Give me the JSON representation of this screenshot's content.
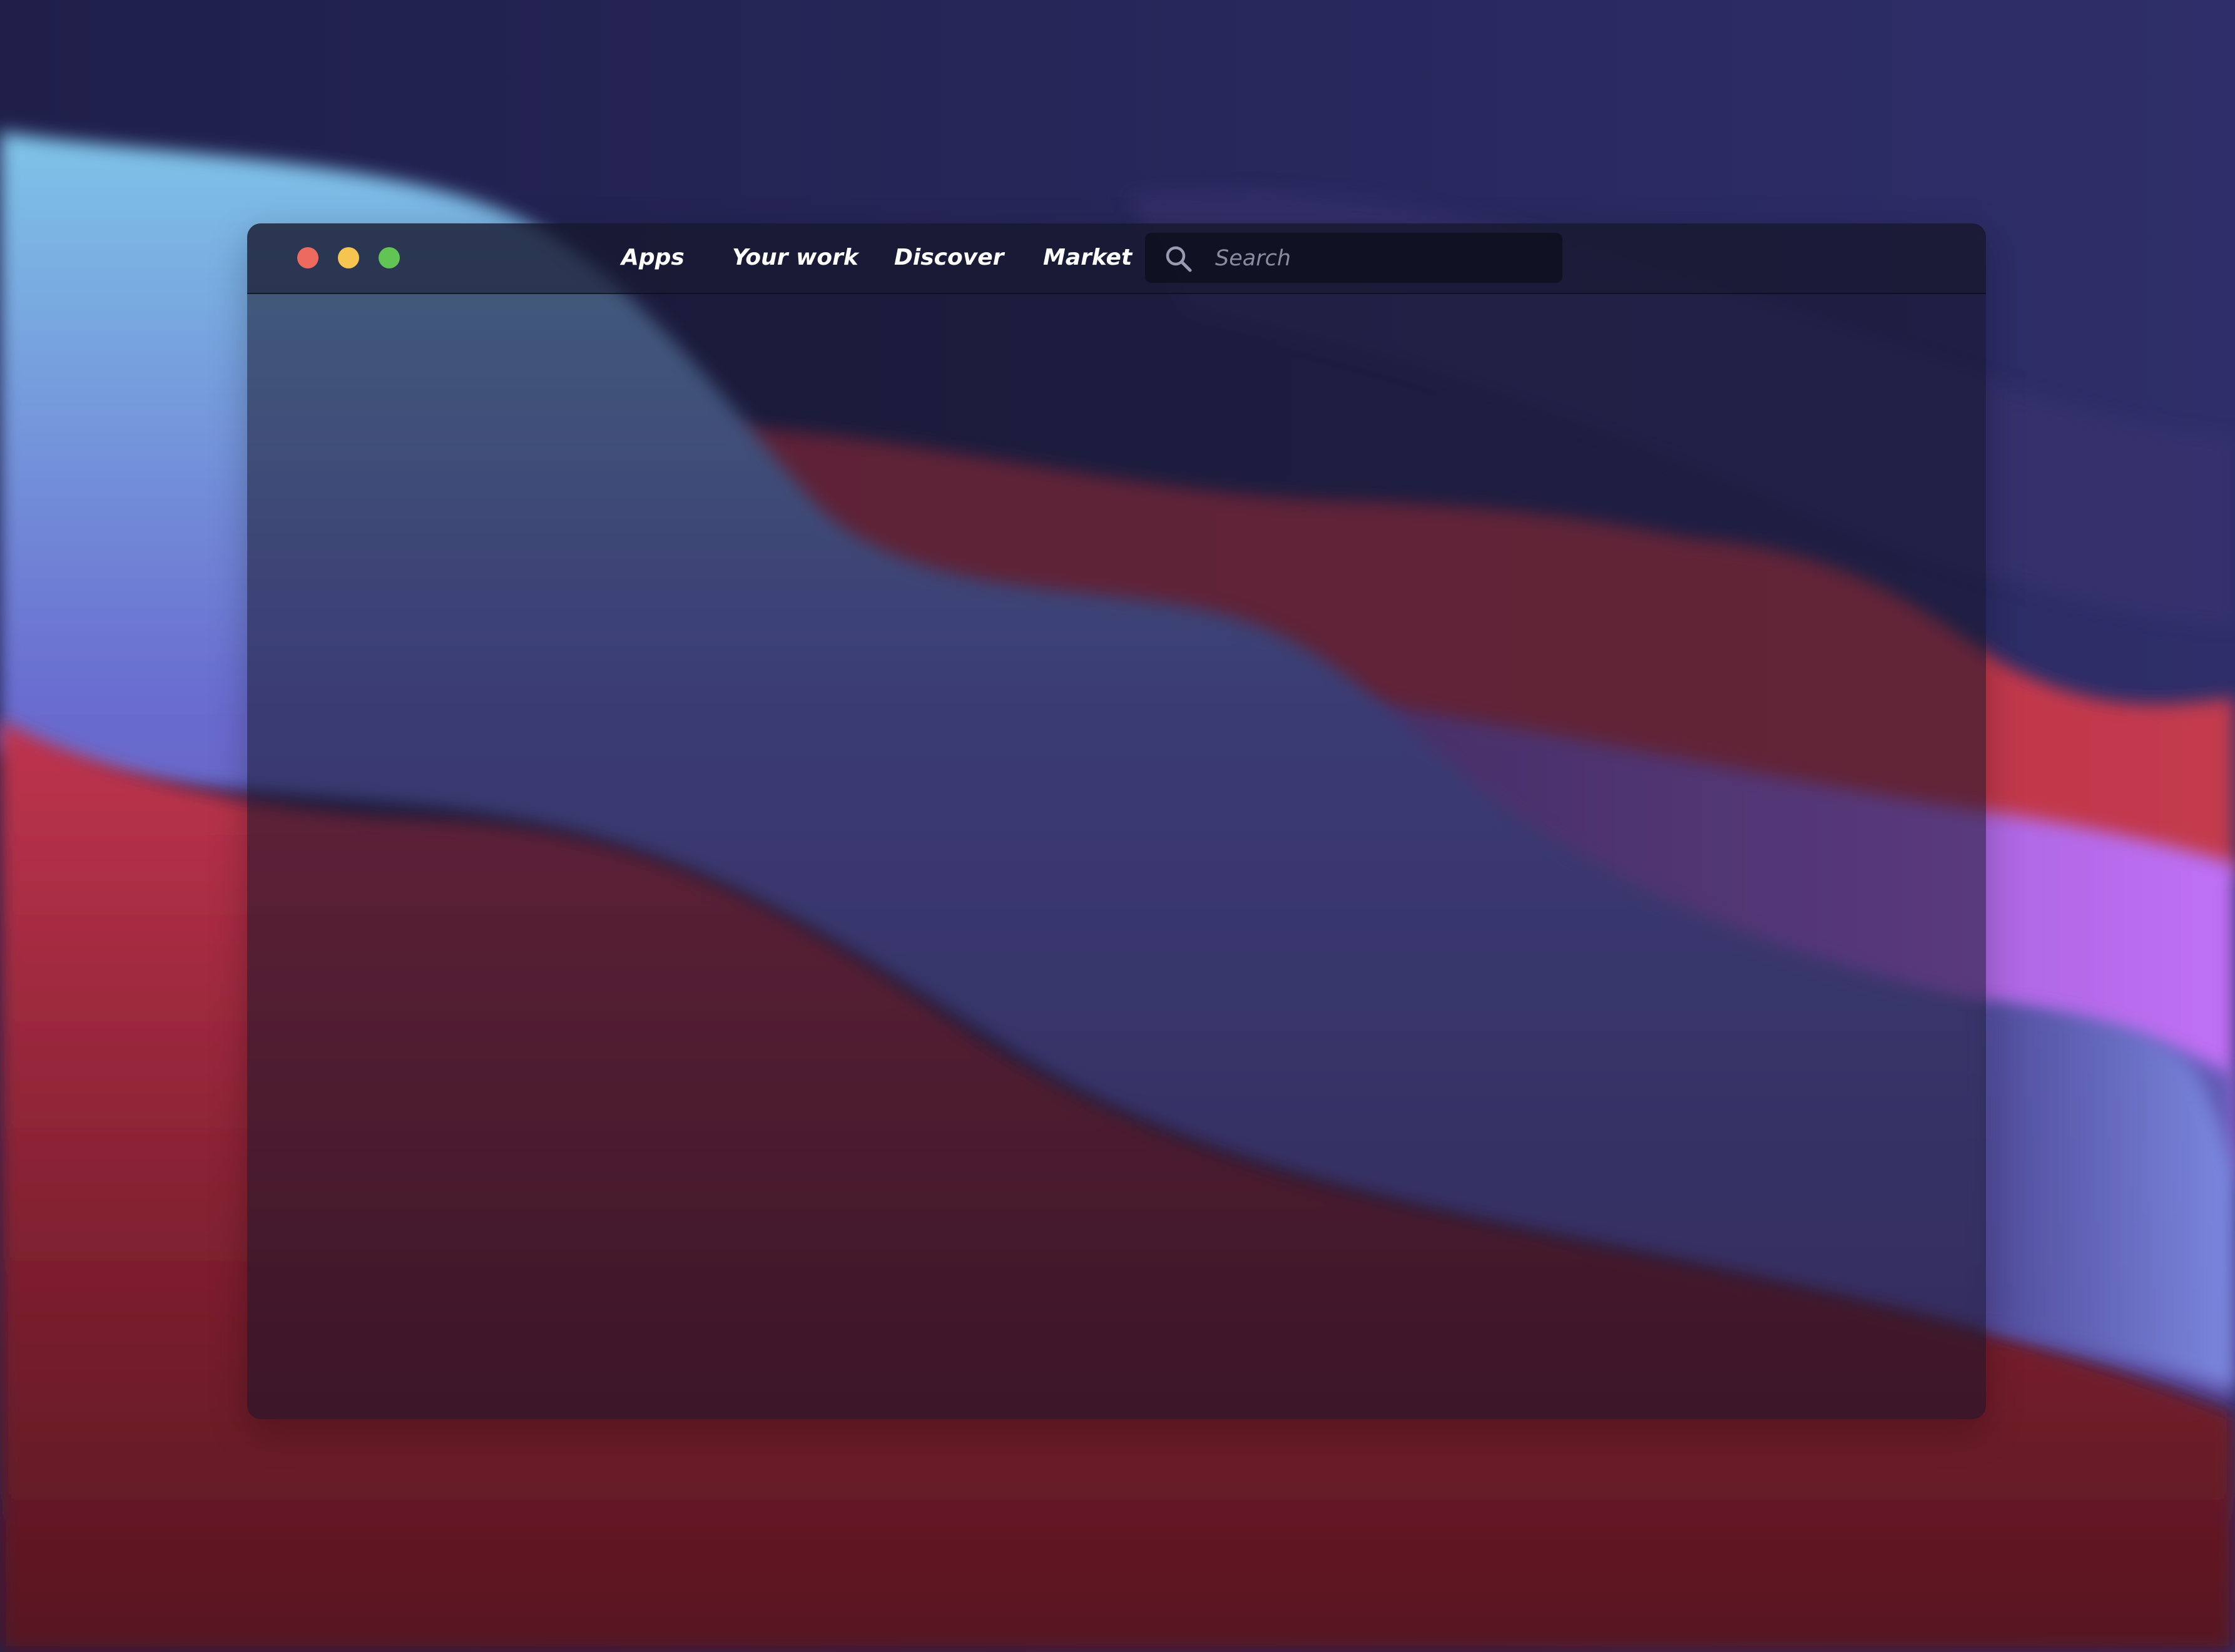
{
  "window": {
    "controls": [
      {
        "name": "close",
        "color": "#ee6a5f"
      },
      {
        "name": "minimize",
        "color": "#f5c451"
      },
      {
        "name": "maximize",
        "color": "#61c454"
      }
    ]
  },
  "nav": {
    "items": [
      {
        "label": "Apps"
      },
      {
        "label": "Your work"
      },
      {
        "label": "Discover"
      },
      {
        "label": "Market"
      }
    ]
  },
  "search": {
    "placeholder": "Search",
    "value": "",
    "icon": "search-icon"
  },
  "colors": {
    "wallpaper_base": "#232452",
    "wallpaper_blue": "#7ec2e6",
    "wallpaper_red": "#b8334a",
    "wallpaper_purple": "#b06cf0"
  }
}
